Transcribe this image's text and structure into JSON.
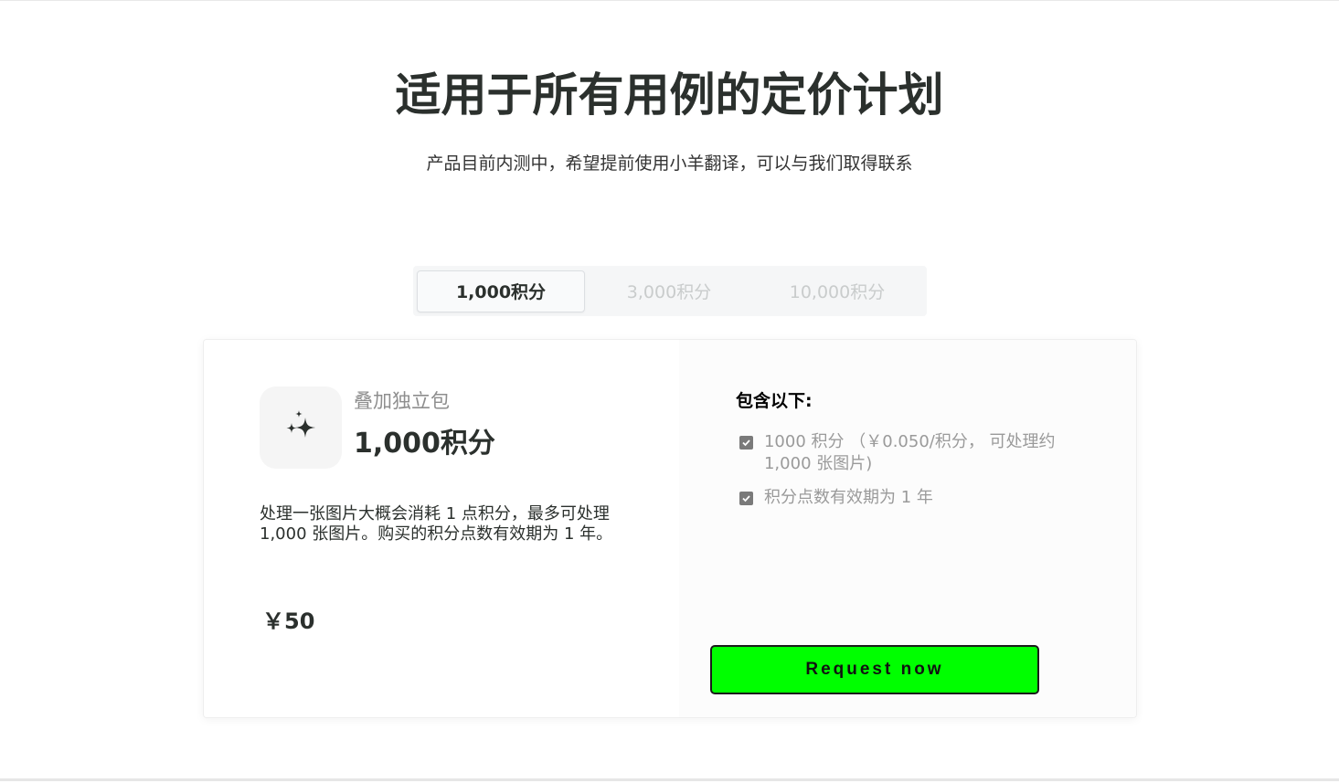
{
  "header": {
    "title": "适用于所有用例的定价计划",
    "subtitle": "产品目前内测中，希望提前使用小羊翻译，可以与我们取得联系"
  },
  "tabs": [
    {
      "label": "1,000积分",
      "active": true
    },
    {
      "label": "3,000积分",
      "active": false
    },
    {
      "label": "10,000积分",
      "active": false
    }
  ],
  "plan": {
    "icon": "sparkles-icon",
    "label": "叠加独立包",
    "name": "1,000积分",
    "description": "处理一张图片大概会消耗 1 点积分，最多可处理 1,000 张图片。购买的积分点数有效期为 1 年。",
    "price": "￥50"
  },
  "includes": {
    "title": "包含以下:",
    "features": [
      "1000 积分 （￥0.050/积分， 可处理约 1,000 张图片)",
      "积分点数有效期为 1 年"
    ]
  },
  "cta": {
    "label": "Request now",
    "color": "#00ff00"
  }
}
